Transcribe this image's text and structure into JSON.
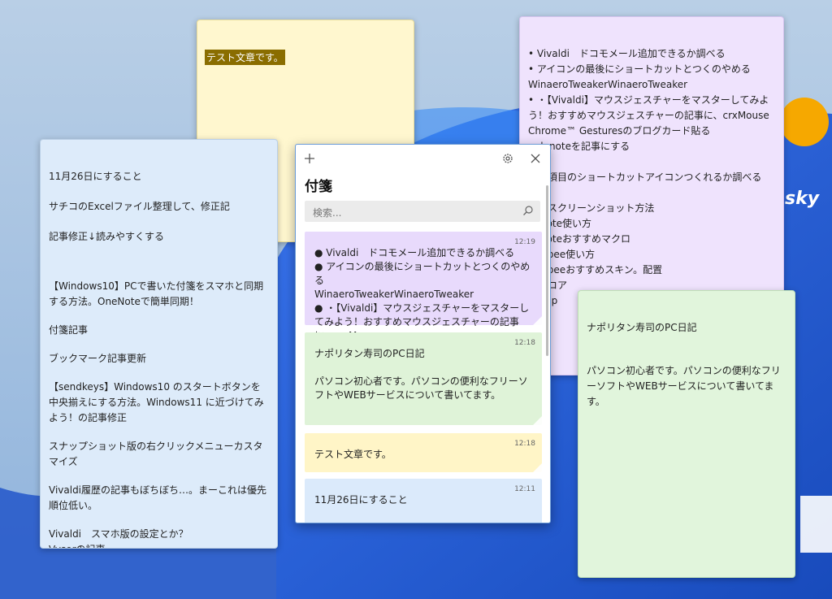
{
  "wallpaper": {
    "logo_text": "sky"
  },
  "yellow_note": {
    "text": "テスト文章です。"
  },
  "blue_note": {
    "lines": [
      "11月26日にすること",
      "サチコのExcelファイル整理して、修正記",
      "記事修正↓読みやすくする",
      "",
      "【Windows10】PCで書いた付箋をスマホと同期する方法。OneNoteで簡単同期！",
      "付箋記事",
      "ブックマーク記事更新",
      "【sendkeys】Windows10 のスタートボタンを中央揃えにする方法。Windows11 に近づけてみよう！の記事修正",
      "スナップショット版の右クリックメニューカスタマイズ",
      "Vivaldi履歴の記事もぼちぼち…。まーこれは優先順位低い。",
      "Vivaldi　スマホ版の設定とか？\nVysorの記事"
    ]
  },
  "purple_note": {
    "lines": [
      "• Vivaldi　ドコモメール追加できるか調べる",
      "• アイコンの最後にショートカットとつくのやめる WinaeroTweakerWinaeroTweaker",
      "• ・【Vivaldi】マウスジェスチャーをマスターしてみよう！おすすめマウスジェスチャーの記事に、crxMouse Chrome™ Gesturesのブログカード貼る",
      "nplenoteを記事にする",
      "",
      "定の項目のショートカットアイコンつくれるか調べる",
      "",
      "々なスクリーンショット方法",
      "nenote使い方",
      "nenoteおすすめマクロ",
      "usicbee使い方",
      "usicbeeおすすめスキン。配置",
      "ンドコア",
      "azonp"
    ]
  },
  "green_note": {
    "title": "ナポリタン寿司のPC日記",
    "body": "パソコン初心者です。パソコンの便利なフリーソフトやWEBサービスについて書いてます。"
  },
  "window": {
    "title": "付箋",
    "search_placeholder": "検索...",
    "notes": [
      {
        "time": "12:19",
        "text": "● Vivaldi　ドコモメール追加できるか調べる\n● アイコンの最後にショートカットとつくのやめる\nWinaeroTweakerWinaeroTweaker\n● ・【Vivaldi】マウスジェスチャーをマスターしてみよう！おすすめマウスジェスチャーの記事に、crxMouse…"
      },
      {
        "time": "12:18",
        "text": "ナポリタン寿司のPC日記\n\nパソコン初心者です。パソコンの便利なフリーソフトやWEBサービスについて書いてます。"
      },
      {
        "time": "12:18",
        "text": "テスト文章です。"
      },
      {
        "time": "12:11",
        "text": "11月26日にすること"
      }
    ]
  }
}
